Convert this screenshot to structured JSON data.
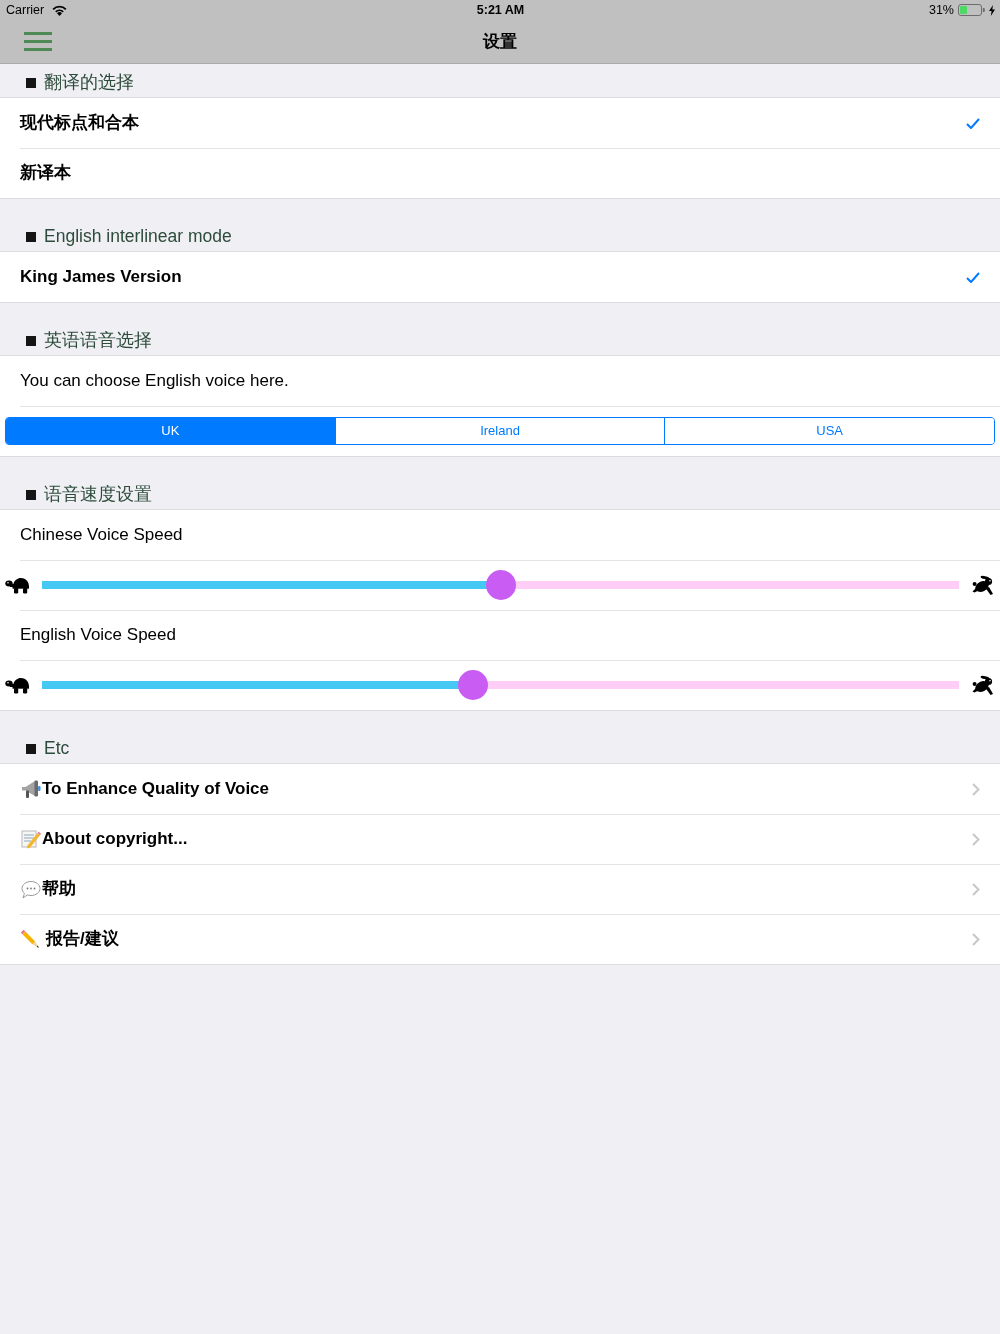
{
  "status_bar": {
    "carrier": "Carrier",
    "time": "5:21 AM",
    "battery": "31%"
  },
  "nav_bar": {
    "title": "设置"
  },
  "sections": [
    {
      "header": "翻译的选择",
      "rows": [
        {
          "kind": "option",
          "label": "现代标点和合本",
          "selected": true
        },
        {
          "kind": "option",
          "label": "新译本",
          "selected": false
        }
      ]
    },
    {
      "header": "English interlinear mode",
      "rows": [
        {
          "kind": "option",
          "label": "King James Version",
          "selected": true
        }
      ]
    },
    {
      "header": "英语语音选择",
      "rows": [
        {
          "kind": "text",
          "label": "You can choose English voice here."
        },
        {
          "kind": "segmented",
          "segments": [
            {
              "label": "UK",
              "selected": true
            },
            {
              "label": "Ireland",
              "selected": false
            },
            {
              "label": "USA",
              "selected": false
            }
          ]
        }
      ]
    },
    {
      "header": "语音速度设置",
      "rows": [
        {
          "kind": "text",
          "label": "Chinese Voice Speed"
        },
        {
          "kind": "slider",
          "level": 0.5
        },
        {
          "kind": "text",
          "label": "English Voice Speed"
        },
        {
          "kind": "slider",
          "level": 0.47
        }
      ]
    },
    {
      "header": "Etc",
      "rows": [
        {
          "kind": "link",
          "label": "To Enhance Quality of Voice"
        },
        {
          "kind": "link",
          "label": "About copyright..."
        },
        {
          "kind": "link",
          "label": "帮助"
        },
        {
          "kind": "link",
          "label": "报告/建议"
        }
      ]
    }
  ]
}
